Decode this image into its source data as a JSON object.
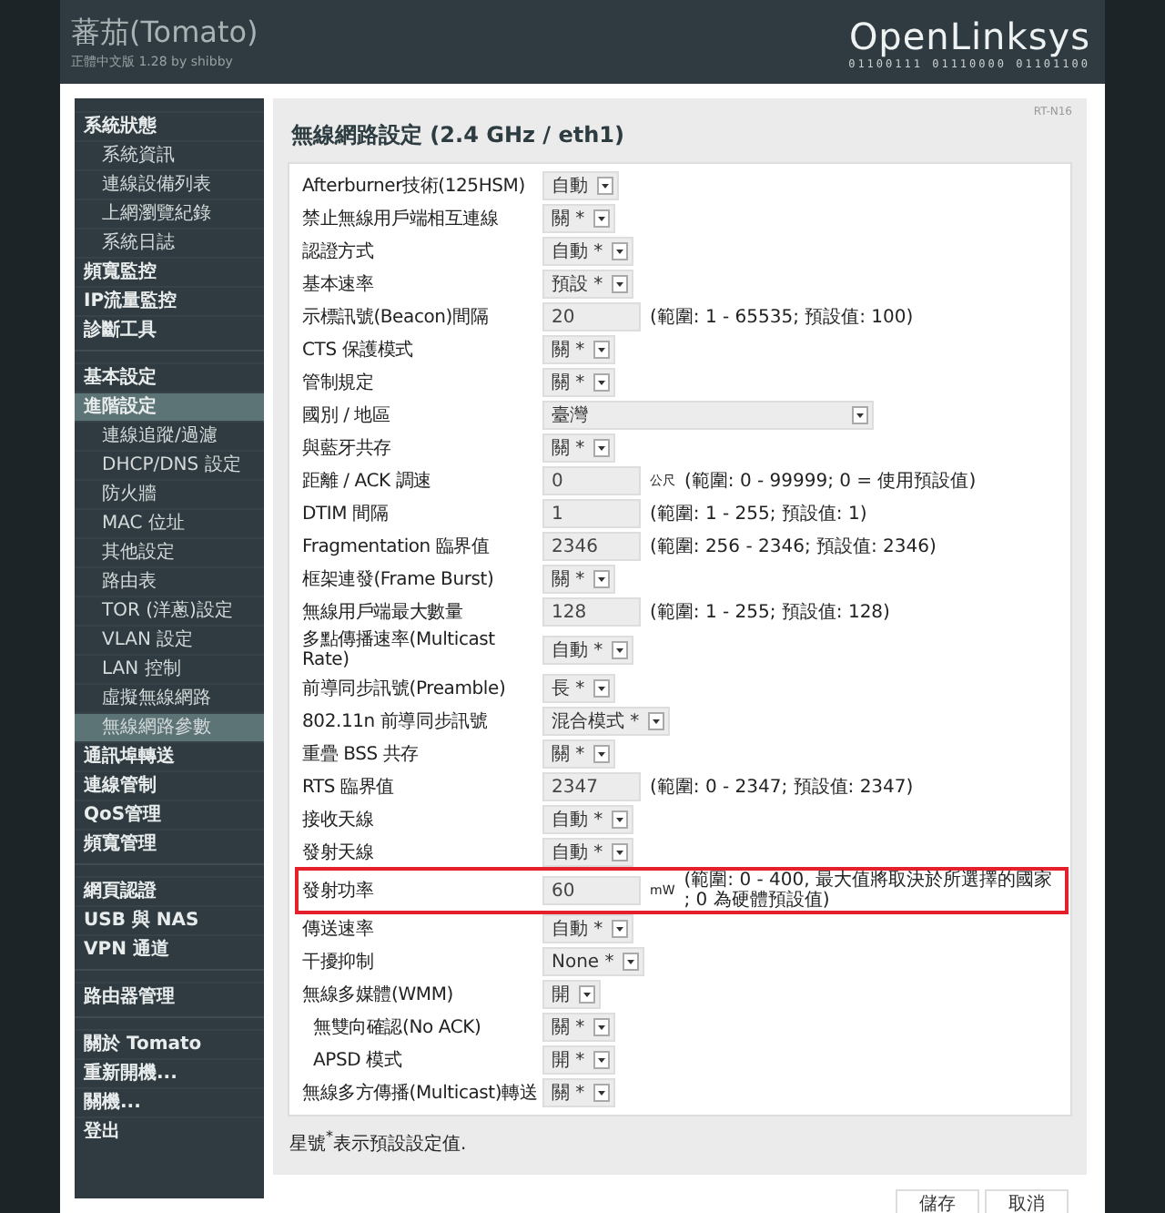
{
  "header": {
    "title": "蕃茄(Tomato)",
    "subtitle": "正體中文版 1.28 by shibby",
    "logo": "OpenLinksys",
    "logo_binary": "01100111 01110000 01101100"
  },
  "sidebar": {
    "sections": [
      [
        {
          "label": "系統狀態",
          "selected": false,
          "children": [
            {
              "label": "系統資訊",
              "selected": false
            },
            {
              "label": "連線設備列表",
              "selected": false
            },
            {
              "label": "上網瀏覽紀錄",
              "selected": false
            },
            {
              "label": "系統日誌",
              "selected": false
            }
          ]
        },
        {
          "label": "頻寬監控",
          "selected": false
        },
        {
          "label": "IP流量監控",
          "selected": false
        },
        {
          "label": "診斷工具",
          "selected": false
        }
      ],
      [
        {
          "label": "基本設定",
          "selected": false
        },
        {
          "label": "進階設定",
          "selected": true,
          "children": [
            {
              "label": "連線追蹤/過濾",
              "selected": false
            },
            {
              "label": "DHCP/DNS 設定",
              "selected": false
            },
            {
              "label": "防火牆",
              "selected": false
            },
            {
              "label": "MAC 位址",
              "selected": false
            },
            {
              "label": "其他設定",
              "selected": false
            },
            {
              "label": "路由表",
              "selected": false
            },
            {
              "label": "TOR (洋蔥)設定",
              "selected": false
            },
            {
              "label": "VLAN 設定",
              "selected": false
            },
            {
              "label": "LAN 控制",
              "selected": false
            },
            {
              "label": "虛擬無線網路",
              "selected": false
            },
            {
              "label": "無線網路參數",
              "selected": true
            }
          ]
        },
        {
          "label": "通訊埠轉送",
          "selected": false
        },
        {
          "label": "連線管制",
          "selected": false
        },
        {
          "label": "QoS管理",
          "selected": false
        },
        {
          "label": "頻寬管理",
          "selected": false
        }
      ],
      [
        {
          "label": "網頁認證",
          "selected": false
        },
        {
          "label": "USB 與 NAS",
          "selected": false
        },
        {
          "label": "VPN 通道",
          "selected": false
        }
      ],
      [
        {
          "label": "路由器管理",
          "selected": false
        }
      ],
      [
        {
          "label": "關於 Tomato",
          "selected": false
        },
        {
          "label": "重新開機...",
          "selected": false
        },
        {
          "label": "關機...",
          "selected": false
        },
        {
          "label": "登出",
          "selected": false
        }
      ]
    ]
  },
  "panel": {
    "model": "RT-N16",
    "title": "無線網路設定 (2.4 GHz / eth1)",
    "rows": [
      {
        "label": "Afterburner技術(125HSM)",
        "kind": "select",
        "value": "自動",
        "highlighted": false
      },
      {
        "label": "禁止無線用戶端相互連線",
        "kind": "select",
        "value": "關 *",
        "highlighted": false
      },
      {
        "label": "認證方式",
        "kind": "select",
        "value": "自動 *",
        "highlighted": false
      },
      {
        "label": "基本速率",
        "kind": "select",
        "value": "預設 *",
        "highlighted": false
      },
      {
        "label": "示標訊號(Beacon)間隔",
        "kind": "input",
        "value": "20",
        "hint": "(範圍: 1 - 65535; 預設值: 100)",
        "highlighted": false
      },
      {
        "label": "CTS 保護模式",
        "kind": "select",
        "value": "關 *",
        "highlighted": false
      },
      {
        "label": "管制規定",
        "kind": "select",
        "value": "關 *",
        "highlighted": false
      },
      {
        "label": "國別 / 地區",
        "kind": "wide-select",
        "value": "臺灣",
        "highlighted": false
      },
      {
        "label": "與藍牙共存",
        "kind": "select",
        "value": "關 *",
        "highlighted": false
      },
      {
        "label": "距離 / ACK 調速",
        "kind": "input",
        "value": "0",
        "unit": "公尺",
        "hint": "(範圍: 0 - 99999; 0 = 使用預設值)",
        "highlighted": false
      },
      {
        "label": "DTIM 間隔",
        "kind": "input",
        "value": "1",
        "hint": "(範圍: 1 - 255; 預設值: 1)",
        "highlighted": false
      },
      {
        "label": "Fragmentation 臨界值",
        "kind": "input",
        "value": "2346",
        "hint": "(範圍: 256 - 2346; 預設值: 2346)",
        "highlighted": false
      },
      {
        "label": "框架連發(Frame Burst)",
        "kind": "select",
        "value": "關 *",
        "highlighted": false
      },
      {
        "label": "無線用戶端最大數量",
        "kind": "input",
        "value": "128",
        "hint": "(範圍: 1 - 255; 預設值: 128)",
        "highlighted": false
      },
      {
        "label": "多點傳播速率(Multicast Rate)",
        "kind": "select",
        "value": "自動 *",
        "highlighted": false
      },
      {
        "label": "前導同步訊號(Preamble)",
        "kind": "select",
        "value": "長 *",
        "highlighted": false
      },
      {
        "label": "802.11n 前導同步訊號",
        "kind": "select",
        "value": "混合模式 *",
        "highlighted": false
      },
      {
        "label": "重疊 BSS 共存",
        "kind": "select",
        "value": "關 *",
        "highlighted": false
      },
      {
        "label": "RTS 臨界值",
        "kind": "input",
        "value": "2347",
        "hint": "(範圍: 0 - 2347; 預設值: 2347)",
        "highlighted": false
      },
      {
        "label": "接收天線",
        "kind": "select",
        "value": "自動 *",
        "highlighted": false
      },
      {
        "label": "發射天線",
        "kind": "select",
        "value": "自動 *",
        "highlighted": false
      },
      {
        "label": "發射功率",
        "kind": "input",
        "value": "60",
        "unit": "mW",
        "hint": "(範圍: 0 - 400, 最大值將取決於所選擇的國家 ; 0 為硬體預設值)",
        "highlighted": true
      },
      {
        "label": "傳送速率",
        "kind": "select",
        "value": "自動 *",
        "highlighted": false
      },
      {
        "label": "干擾抑制",
        "kind": "select",
        "value": "None *",
        "highlighted": false
      },
      {
        "label": "無線多媒體(WMM)",
        "kind": "select",
        "value": "開",
        "highlighted": false,
        "children": [
          {
            "label": "無雙向確認(No ACK)",
            "kind": "select",
            "value": "關 *",
            "highlighted": false
          },
          {
            "label": "APSD 模式",
            "kind": "select",
            "value": "開 *",
            "highlighted": false
          }
        ]
      },
      {
        "label": "無線多方傳播(Multicast)轉送",
        "kind": "select",
        "value": "關 *",
        "highlighted": false
      }
    ],
    "note": "星號$^{*}$表示預設設定值."
  },
  "buttons": [
    "儲存",
    "取消"
  ]
}
